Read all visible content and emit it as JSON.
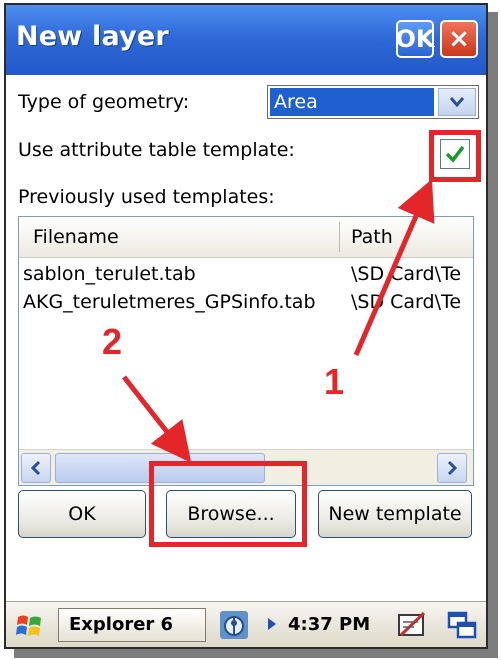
{
  "window": {
    "title": "New layer",
    "ok_label": "OK",
    "close_label": "×"
  },
  "form": {
    "geometry_label": "Type of geometry:",
    "geometry_value": "Area",
    "template_label": "Use attribute table template:",
    "template_checked": true,
    "previous_label": "Previously used templates:"
  },
  "list": {
    "columns": [
      "Filename",
      "Path"
    ],
    "rows": [
      {
        "filename": "sablon_terulet.tab",
        "path": "\\SD Card\\Te"
      },
      {
        "filename": "AKG_teruletmeres_GPSinfo.tab",
        "path": "\\SD Card\\Te"
      }
    ]
  },
  "buttons": {
    "ok": "OK",
    "browse": "Browse...",
    "new_template": "New template"
  },
  "annotations": {
    "callout_1": "1",
    "callout_2": "2",
    "color": "#e4262a"
  },
  "taskbar": {
    "task_label": "Explorer 6",
    "time": "4:37 PM"
  },
  "colors": {
    "titlebar": "#2f6ad8",
    "selection": "#1f5fcf",
    "checkmark": "#1a9a2c",
    "callout": "#e4262a"
  }
}
